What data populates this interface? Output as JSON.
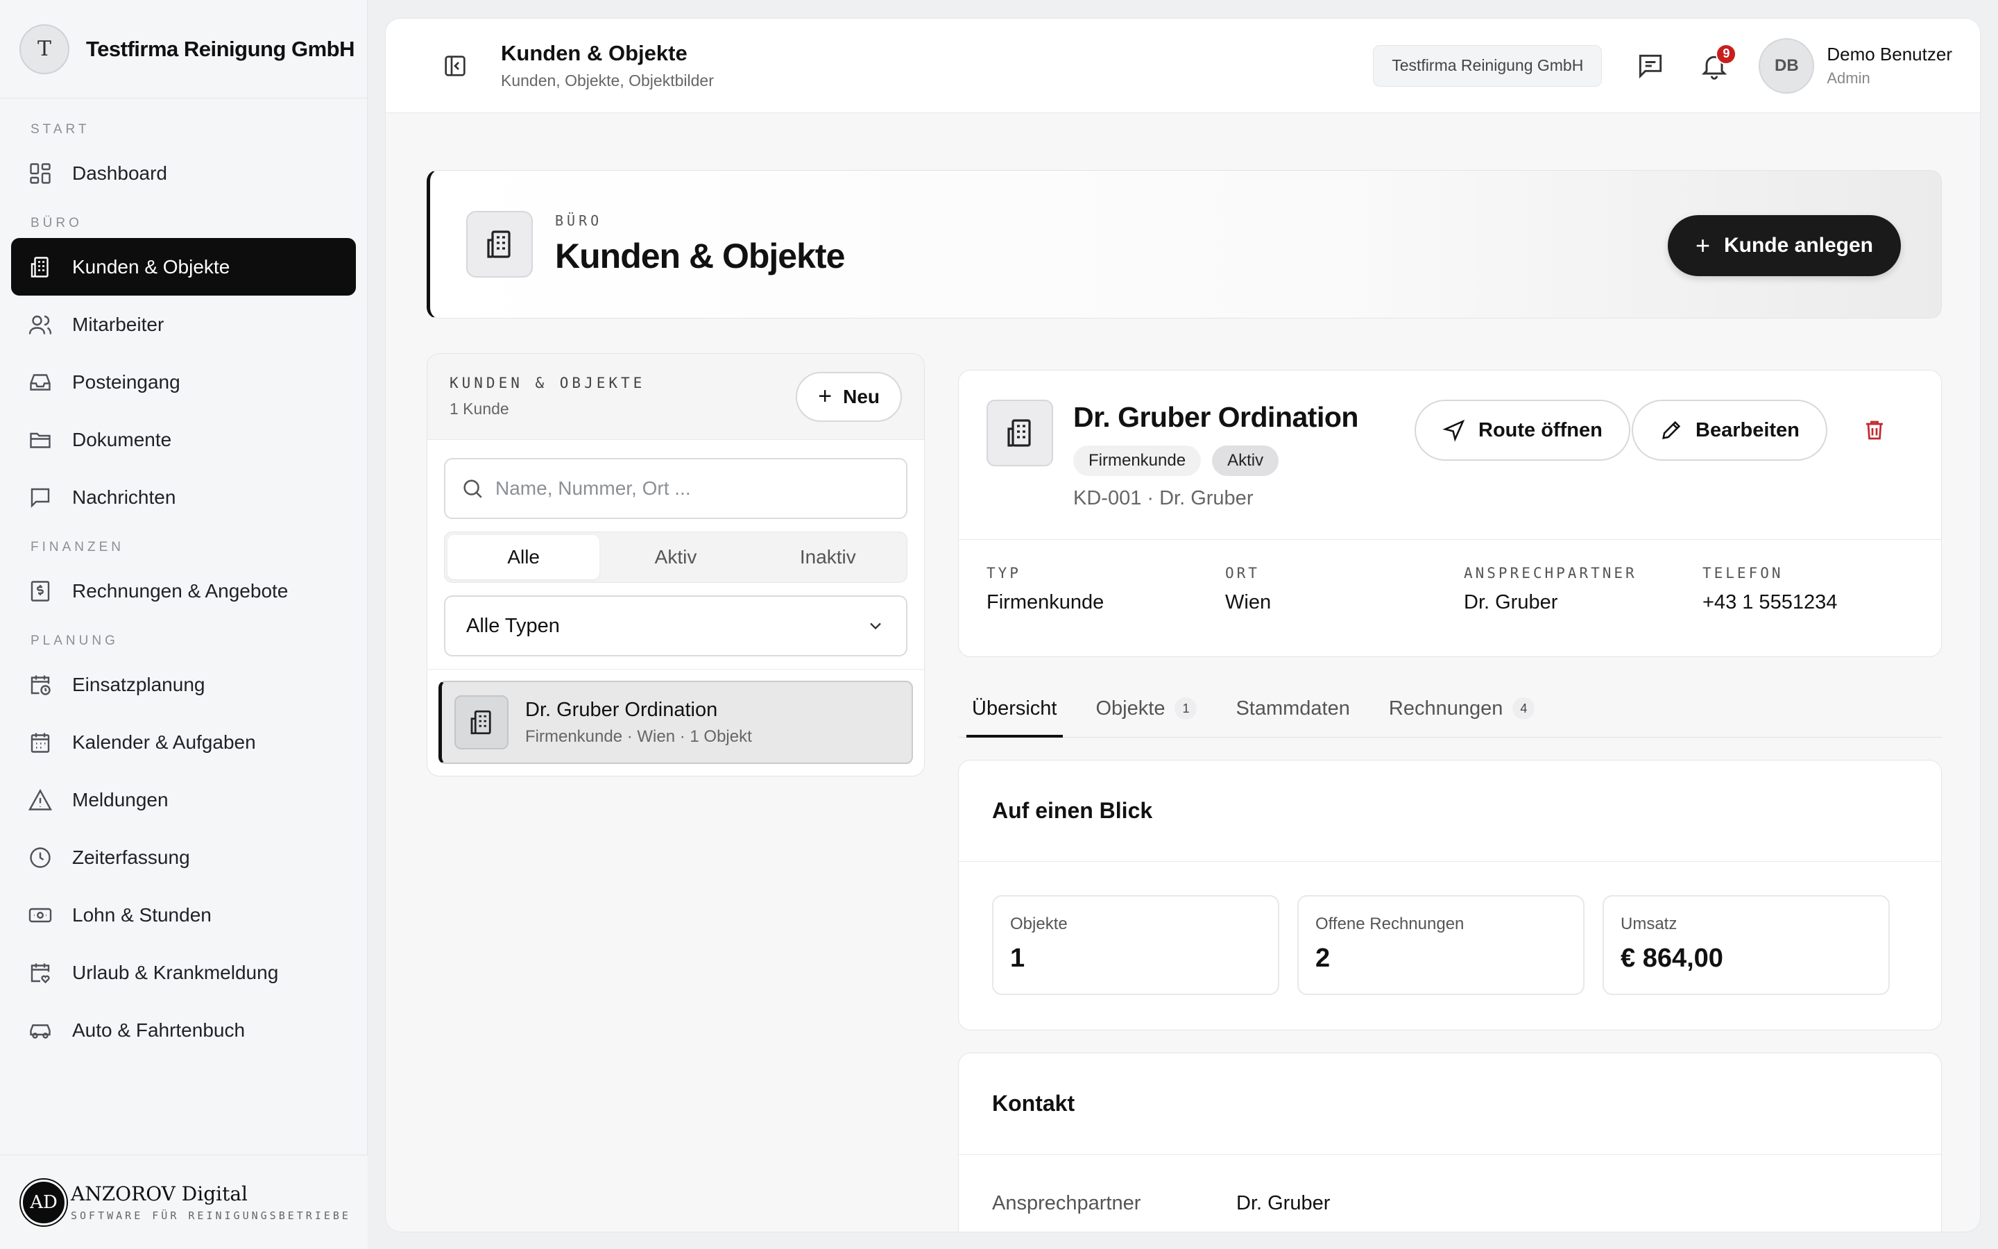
{
  "brand": {
    "initial": "T",
    "name": "Testfirma Reinigung GmbH"
  },
  "nav": {
    "sections": {
      "start": "START",
      "buero": "BÜRO",
      "finanzen": "FINANZEN",
      "planung": "PLANUNG"
    },
    "items": [
      {
        "label": "Dashboard",
        "icon": "dashboard-icon"
      },
      {
        "label": "Kunden & Objekte",
        "icon": "building-icon",
        "active": true
      },
      {
        "label": "Mitarbeiter",
        "icon": "users-icon"
      },
      {
        "label": "Posteingang",
        "icon": "inbox-icon"
      },
      {
        "label": "Dokumente",
        "icon": "folder-icon"
      },
      {
        "label": "Nachrichten",
        "icon": "message-icon"
      },
      {
        "label": "Rechnungen & Angebote",
        "icon": "invoice-icon"
      },
      {
        "label": "Einsatzplanung",
        "icon": "calendar-clock-icon"
      },
      {
        "label": "Kalender & Aufgaben",
        "icon": "calendar-icon"
      },
      {
        "label": "Meldungen",
        "icon": "warning-icon"
      },
      {
        "label": "Zeiterfassung",
        "icon": "clock-icon"
      },
      {
        "label": "Lohn & Stunden",
        "icon": "banknote-icon"
      },
      {
        "label": "Urlaub & Krankmeldung",
        "icon": "calendar-heart-icon"
      },
      {
        "label": "Auto & Fahrtenbuch",
        "icon": "car-icon"
      }
    ]
  },
  "footer": {
    "logo": "AD",
    "title": "ANZOROV Digital",
    "subtitle": "SOFTWARE FÜR REINIGUNGSBETRIEBE"
  },
  "topbar": {
    "title": "Kunden & Objekte",
    "subtitle": "Kunden, Objekte, Objektbilder",
    "company": "Testfirma Reinigung GmbH",
    "notifications": "9",
    "user_initials": "DB",
    "user_name": "Demo Benutzer",
    "user_role": "Admin"
  },
  "hero": {
    "eyebrow": "BÜRO",
    "title": "Kunden & Objekte",
    "add_label": "Kunde anlegen"
  },
  "list": {
    "eyebrow": "KUNDEN & OBJEKTE",
    "count": "1 Kunde",
    "new_label": "Neu",
    "search_placeholder": "Name, Nummer, Ort ...",
    "filters": [
      "Alle",
      "Aktiv",
      "Inaktiv"
    ],
    "type_select": "Alle Typen",
    "customers": [
      {
        "name": "Dr. Gruber Ordination",
        "meta": "Firmenkunde · Wien · 1 Objekt"
      }
    ]
  },
  "detail": {
    "name": "Dr. Gruber Ordination",
    "tags": [
      "Firmenkunde",
      "Aktiv"
    ],
    "sub": "KD-001 · Dr. Gruber",
    "route_label": "Route öffnen",
    "edit_label": "Bearbeiten",
    "facts": [
      {
        "key": "TYP",
        "value": "Firmenkunde"
      },
      {
        "key": "ORT",
        "value": "Wien"
      },
      {
        "key": "ANSPRECHPARTNER",
        "value": "Dr. Gruber"
      },
      {
        "key": "TELEFON",
        "value": "+43 1 5551234"
      }
    ]
  },
  "tabs": [
    {
      "label": "Übersicht",
      "count": ""
    },
    {
      "label": "Objekte",
      "count": "1"
    },
    {
      "label": "Stammdaten",
      "count": ""
    },
    {
      "label": "Rechnungen",
      "count": "4"
    }
  ],
  "glance": {
    "title": "Auf einen Blick",
    "stats": [
      {
        "key": "Objekte",
        "value": "1"
      },
      {
        "key": "Offene Rechnungen",
        "value": "2"
      },
      {
        "key": "Umsatz",
        "value": "€ 864,00"
      }
    ]
  },
  "contact": {
    "title": "Kontakt",
    "rows": [
      {
        "key": "Ansprechpartner",
        "value": "Dr. Gruber"
      }
    ]
  },
  "colors": {
    "accent": "#111111",
    "badge": "#c81e1e",
    "danger": "#c0282d"
  }
}
